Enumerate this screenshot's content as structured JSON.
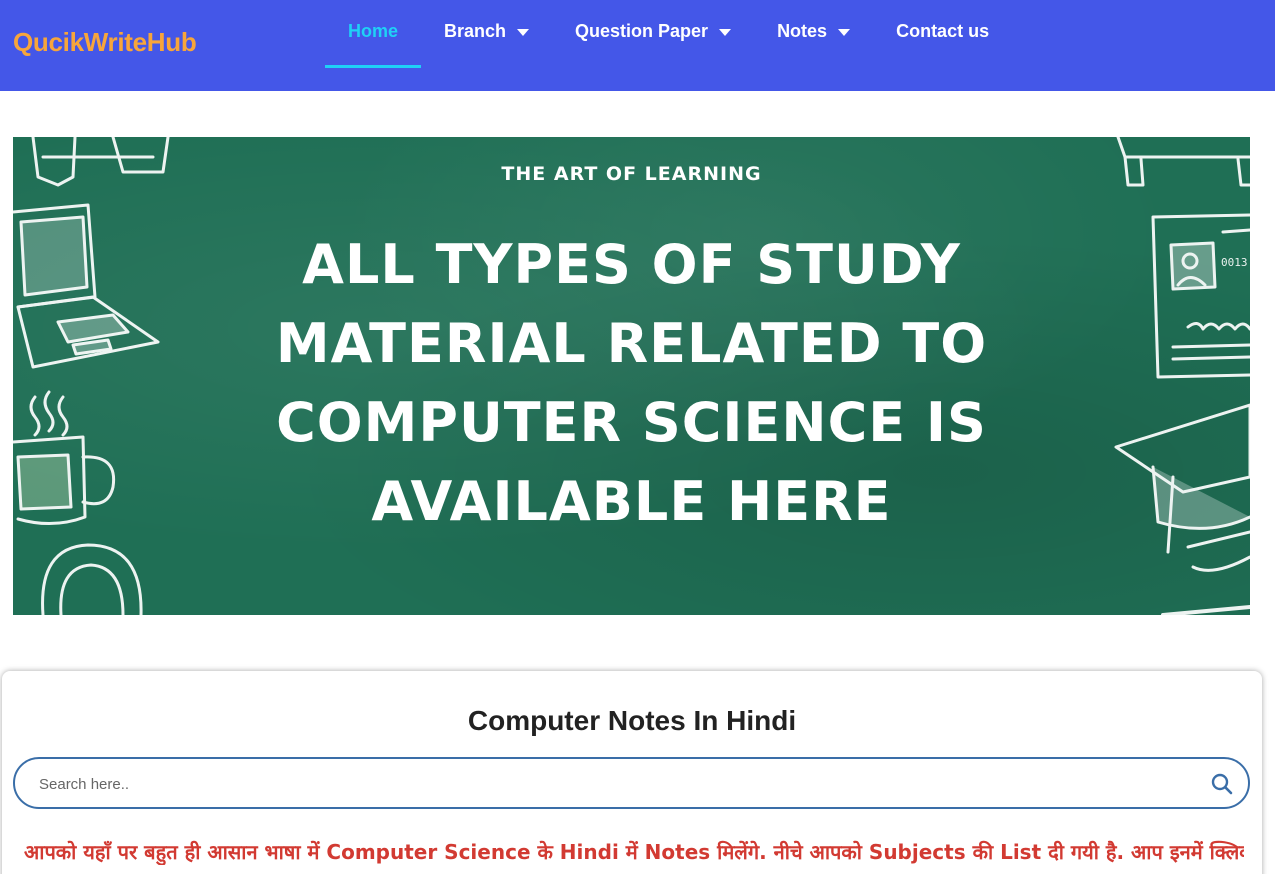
{
  "header": {
    "logo": "QucikWriteHub",
    "nav": [
      {
        "label": "Home",
        "has_dropdown": false,
        "active": true
      },
      {
        "label": "Branch",
        "has_dropdown": true,
        "active": false
      },
      {
        "label": "Question Paper",
        "has_dropdown": true,
        "active": false
      },
      {
        "label": "Notes",
        "has_dropdown": true,
        "active": false
      },
      {
        "label": "Contact us",
        "has_dropdown": false,
        "active": false
      }
    ]
  },
  "hero": {
    "kicker": "THE ART OF LEARNING",
    "title": "ALL TYPES OF STUDY MATERIAL RELATED TO COMPUTER SCIENCE IS AVAILABLE HERE",
    "doodle_label": "0013"
  },
  "card": {
    "title": "Computer Notes In Hindi",
    "search_placeholder": "Search here..",
    "intro": "आपको यहाँ पर बहुत ही आसान भाषा में Computer Science के Hindi में Notes मिलेंगे. नीचे आपको Subjects की List दी गयी है. आप इनमें क्लिक करके पढ़"
  },
  "colors": {
    "header_bg": "#4457e8",
    "logo": "#f7a53b",
    "nav_active": "#1fd1f6",
    "chalkboard": "#1f6f55",
    "search_border": "#3a6ea8",
    "intro_text": "#d23a32"
  },
  "icons": {
    "search": "search-icon",
    "dropdown": "chevron-down-icon"
  }
}
